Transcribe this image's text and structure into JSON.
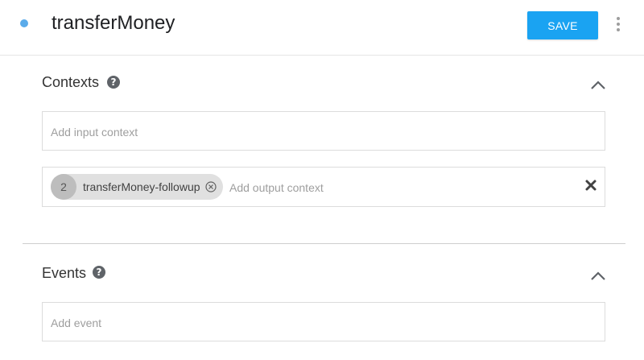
{
  "header": {
    "intent_name": "transferMoney",
    "save_label": "SAVE",
    "status_color": "#5aabea",
    "more_icon": "more-vert-icon"
  },
  "contexts": {
    "title": "Contexts",
    "help_icon": "help-icon",
    "collapse_icon": "chevron-up-icon",
    "input_placeholder": "Add input context",
    "output_contexts": [
      {
        "lifespan": "2",
        "name": "transferMoney-followup"
      }
    ],
    "output_placeholder": "Add output context",
    "clear_icon": "close-icon"
  },
  "events": {
    "title": "Events",
    "help_icon": "help-icon",
    "collapse_icon": "chevron-up-icon",
    "placeholder": "Add event"
  },
  "colors": {
    "accent": "#1aa3f2",
    "chip_bg": "#e0e0e0"
  }
}
